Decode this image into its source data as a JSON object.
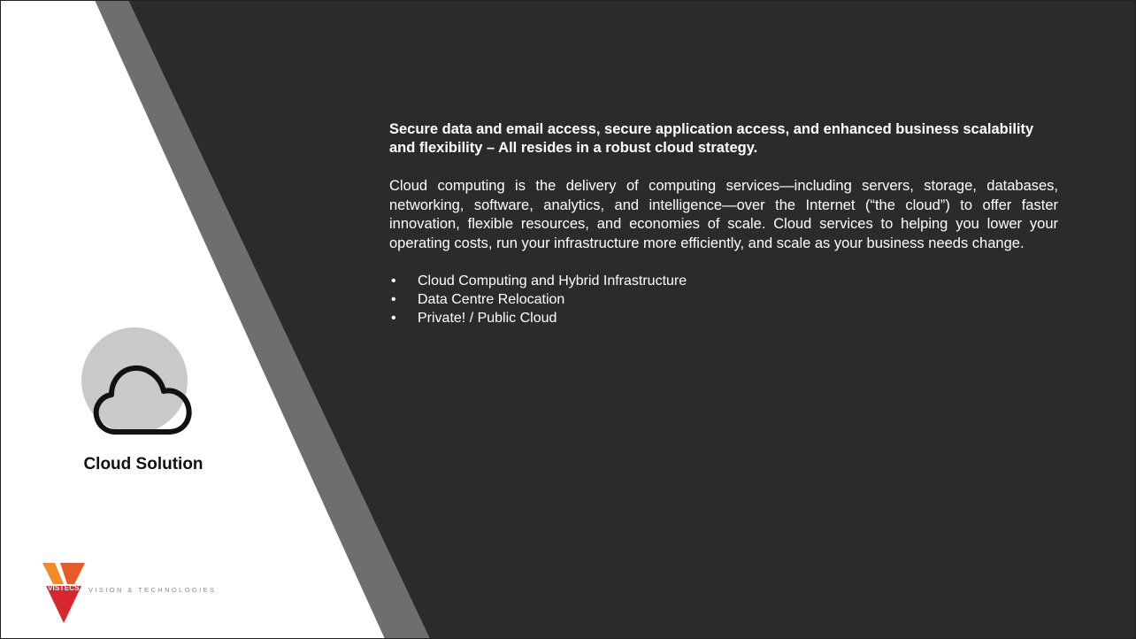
{
  "content": {
    "headline": "Secure data and email access, secure application access, and enhanced business scalability and flexibility –  All resides in a robust cloud strategy.",
    "body": "Cloud computing is the delivery of computing services—including servers, storage, databases, networking, software, analytics, and intelligence—over the Internet (“the cloud”) to offer faster innovation, flexible resources, and economies of scale. Cloud services to helping you lower your operating costs, run your infrastructure more efficiently, and scale as your business needs change.",
    "bullet_symbol": "•",
    "bullets": [
      "Cloud Computing and Hybrid Infrastructure",
      "Data Centre Relocation",
      "Private! / Public Cloud"
    ]
  },
  "section": {
    "title": "Cloud Solution",
    "icon": "cloud-icon"
  },
  "logo": {
    "brand": "VISTECS",
    "tagline": "VISION & TECHNOLOGIES"
  },
  "colors": {
    "panel_dark": "#2b2b2b",
    "diagonal_band": "#6e6e6e",
    "icon_circle": "#c9c9c9",
    "logo_orange": "#f28c28",
    "logo_red": "#d7262f"
  }
}
